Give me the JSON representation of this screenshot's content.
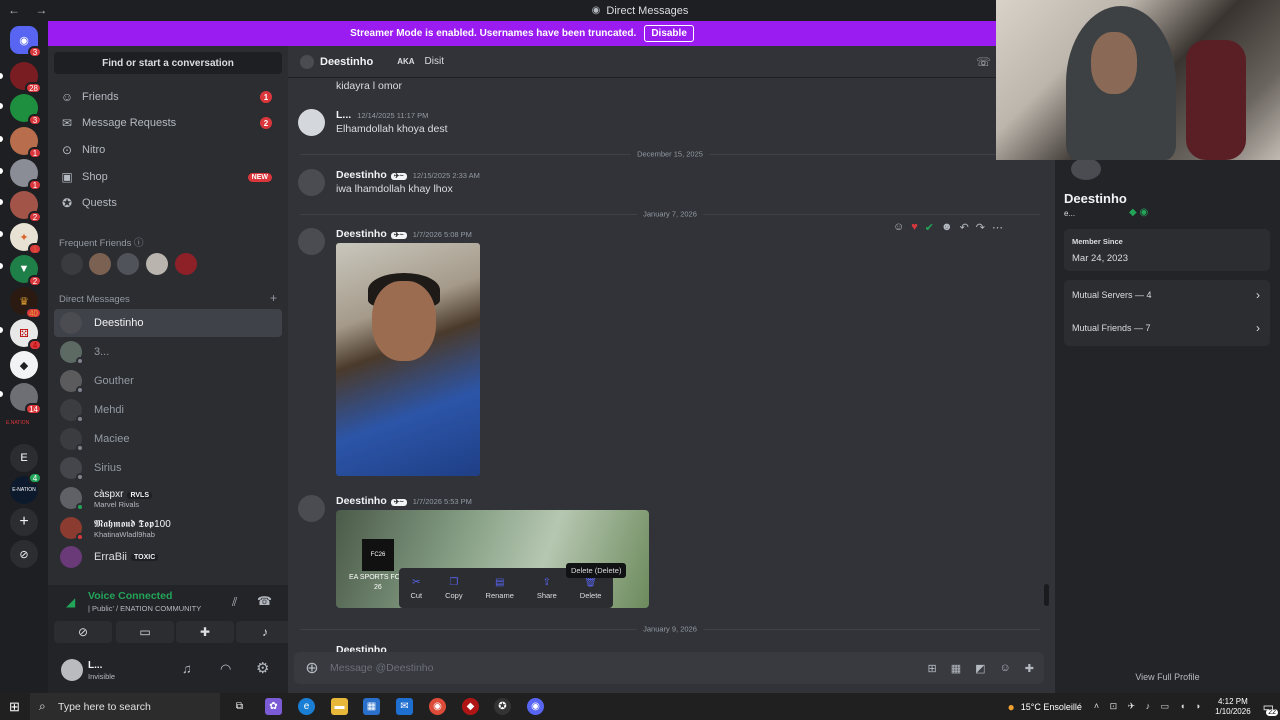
{
  "window": {
    "title": "Direct Messages",
    "nav_arrows": "← →"
  },
  "banner": {
    "text": "Streamer Mode is enabled. Usernames have been truncated.",
    "button": "Disable"
  },
  "guilds": {
    "badges": [
      "3",
      "28",
      "3",
      "1",
      "1",
      "2",
      "1",
      "2",
      "40",
      "4",
      "14",
      "4"
    ],
    "letter_server": "E",
    "small_label": "E-NATION",
    "wordmark": "E.NATION"
  },
  "sidebar": {
    "search_placeholder": "Find or start a conversation",
    "nav": [
      {
        "label": "Friends",
        "count": "1",
        "icon": "friends-icon"
      },
      {
        "label": "Message Requests",
        "count": "2",
        "icon": "mail-icon"
      },
      {
        "label": "Nitro",
        "icon": "nitro-icon"
      },
      {
        "label": "Shop",
        "badge": "NEW",
        "icon": "shop-icon"
      },
      {
        "label": "Quests",
        "icon": "quests-icon"
      }
    ],
    "frequent_friends_title": "Frequent Friends",
    "dm_title": "Direct Messages",
    "dms": [
      {
        "name": "Deestinho",
        "active": true
      },
      {
        "name": "3..."
      },
      {
        "name": "Gouther"
      },
      {
        "name": "Mehdi"
      },
      {
        "name": "Maciee"
      },
      {
        "name": "Sirius"
      },
      {
        "name": "càspxr",
        "tag": "RVLS",
        "activity": "Marvel Rivals"
      },
      {
        "name": "𝕸𝖆𝖍𝖒𝖔𝖚𝖉 𝕿𝖔𝖕100",
        "activity": "KhatinaWladl9hab"
      },
      {
        "name": "ErraBii",
        "tag": "TOXIC"
      }
    ]
  },
  "voice": {
    "status": "Voice Connected",
    "channel": "| Public' / ENATION COMMUNITY"
  },
  "userbar": {
    "name": "L...",
    "status": "Invisible"
  },
  "header": {
    "name": "Deestinho",
    "aka_label": "AKA",
    "aka_value": "Disit"
  },
  "messages": [
    {
      "text": "kidayra l omor"
    },
    {
      "name": "L...",
      "time": "12/14/2025 11:17 PM",
      "text": "Elhamdollah khoya dest"
    },
    {
      "divider": "December 15, 2025"
    },
    {
      "name": "Deestinho",
      "time": "12/15/2025 2:33 AM",
      "text": "iwa lhamdollah khay lhox"
    },
    {
      "divider": "January 7, 2026"
    },
    {
      "name": "Deestinho",
      "time": "1/7/2026 5:08 PM"
    },
    {
      "name": "Deestinho",
      "time": "1/7/2026 5:53 PM"
    },
    {
      "divider": "January 9, 2026"
    },
    {
      "name": "Deestinho"
    }
  ],
  "attachment": {
    "game_label": "EA SPORTS FC",
    "game_num": "26",
    "logo": "FC26"
  },
  "context_menu": {
    "items": [
      "Cut",
      "Copy",
      "Rename",
      "Share",
      "Delete"
    ],
    "tooltip": "Delete (Delete)"
  },
  "composer": {
    "placeholder": "Message @Deestinho"
  },
  "profile": {
    "name": "Deestinho",
    "sub": "e...",
    "member_since_label": "Member Since",
    "member_since": "Mar 24, 2023",
    "mutual_servers": "Mutual Servers — 4",
    "mutual_friends": "Mutual Friends — 7",
    "view_full": "View Full Profile"
  },
  "taskbar": {
    "search": "Type here to search",
    "weather": "15°C  Ensoleillé",
    "time": "4:12 PM",
    "date": "1/10/2026",
    "notif": "22"
  },
  "colors": {
    "accent": "#5865f2",
    "banner": "#9b1cf0",
    "danger": "#da373c",
    "online": "#23a559"
  }
}
